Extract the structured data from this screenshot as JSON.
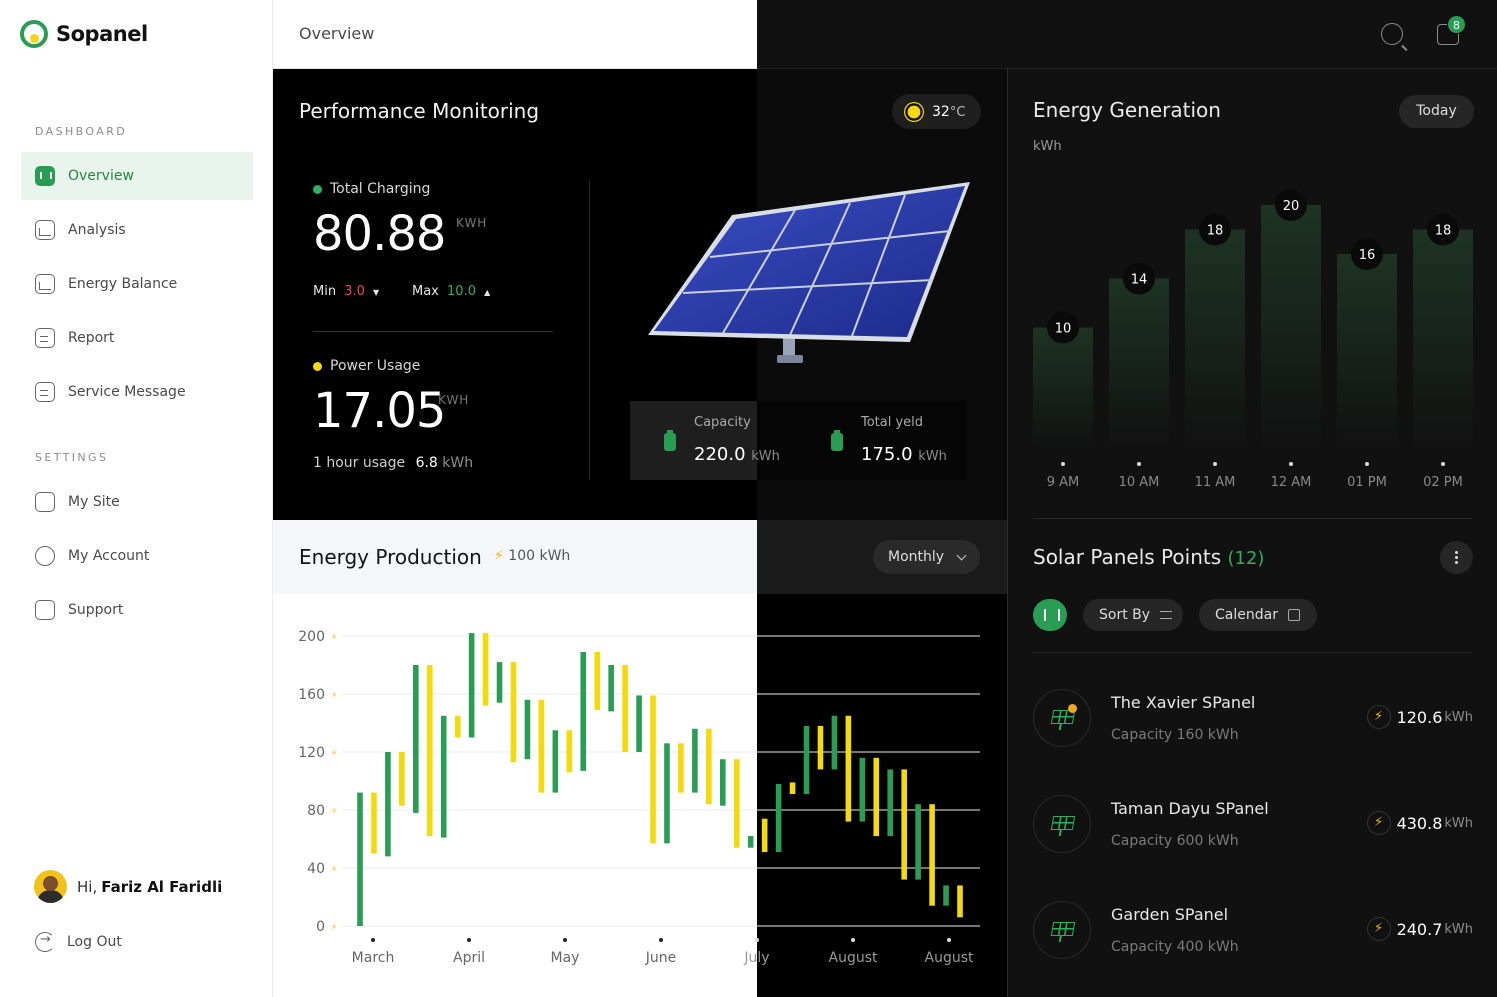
{
  "app": {
    "name": "Sopanel"
  },
  "sidebar": {
    "sections": [
      {
        "label": "DASHBOARD"
      },
      {
        "label": "SETTINGS"
      }
    ],
    "items": [
      {
        "label": "Overview",
        "icon": "overview-icon",
        "active": true
      },
      {
        "label": "Analysis",
        "icon": "analysis-icon"
      },
      {
        "label": "Energy Balance",
        "icon": "energy-balance-icon"
      },
      {
        "label": "Report",
        "icon": "report-icon"
      },
      {
        "label": "Service Message",
        "icon": "service-message-icon"
      },
      {
        "label": "My Site",
        "icon": "my-site-icon"
      },
      {
        "label": "My Account",
        "icon": "my-account-icon"
      },
      {
        "label": "Support",
        "icon": "support-icon"
      }
    ],
    "user": {
      "greeting": "Hi,",
      "name": "Fariz Al Faridli"
    },
    "logout": "Log Out"
  },
  "header": {
    "title": "Overview",
    "notification_count": "8"
  },
  "performance": {
    "title": "Performance Monitoring",
    "temperature": "32",
    "temperature_unit": "°C",
    "total_charging": {
      "label": "Total Charging",
      "value": "80.88",
      "unit": "KWH",
      "min_label": "Min",
      "min": "3.0",
      "max_label": "Max",
      "max": "10.0"
    },
    "power_usage": {
      "label": "Power Usage",
      "value": "17.05",
      "unit": "KWH",
      "usage_label": "1 hour usage",
      "usage_value": "6.8",
      "usage_unit": "kWh"
    },
    "capacity": {
      "label": "Capacity",
      "value": "220.0",
      "unit": "kWh"
    },
    "total_yield": {
      "label": "Total yeld",
      "value": "175.0",
      "unit": "kWh"
    }
  },
  "production": {
    "title": "Energy Production",
    "total": "100 kWh",
    "period": "Monthly"
  },
  "generation": {
    "title": "Energy Generation",
    "unit": "kWh",
    "period": "Today"
  },
  "solar_panels": {
    "title": "Solar Panels Points",
    "count": "(12)",
    "sort_label": "Sort By",
    "calendar_label": "Calendar",
    "items": [
      {
        "name": "The Xavier SPanel",
        "capacity": "Capacity 160 kWh",
        "value": "120.6",
        "unit": "kWh",
        "alert": true
      },
      {
        "name": "Taman Dayu SPanel",
        "capacity": "Capacity 600 kWh",
        "value": "430.8",
        "unit": "kWh"
      },
      {
        "name": "Garden SPanel",
        "capacity": "Capacity 400 kWh",
        "value": "240.7",
        "unit": "kWh"
      }
    ]
  },
  "colors": {
    "accent_green": "#2a9d55",
    "accent_yellow": "#f5d90e",
    "down_red": "#e94b4b",
    "up_green": "#2fae5e"
  },
  "chart_data": [
    {
      "type": "bar",
      "name": "Energy Production",
      "chart_style": "floating range bars (candlestick-like), alternating green/yellow",
      "ylim": [
        0,
        200
      ],
      "yticks": [
        0,
        40,
        80,
        120,
        160,
        200
      ],
      "x_ticks": [
        "March",
        "April",
        "May",
        "June",
        "July",
        "August",
        "August"
      ],
      "ranges": [
        {
          "low": 0,
          "high": 92,
          "color": "green"
        },
        {
          "low": 50,
          "high": 92,
          "color": "yellow"
        },
        {
          "low": 48,
          "high": 120,
          "color": "green"
        },
        {
          "low": 83,
          "high": 120,
          "color": "yellow"
        },
        {
          "low": 78,
          "high": 180,
          "color": "green"
        },
        {
          "low": 62,
          "high": 180,
          "color": "yellow"
        },
        {
          "low": 61,
          "high": 145,
          "color": "green"
        },
        {
          "low": 130,
          "high": 145,
          "color": "yellow"
        },
        {
          "low": 130,
          "high": 202,
          "color": "green"
        },
        {
          "low": 152,
          "high": 202,
          "color": "yellow"
        },
        {
          "low": 154,
          "high": 182,
          "color": "green"
        },
        {
          "low": 113,
          "high": 182,
          "color": "yellow"
        },
        {
          "low": 115,
          "high": 156,
          "color": "green"
        },
        {
          "low": 92,
          "high": 156,
          "color": "yellow"
        },
        {
          "low": 92,
          "high": 135,
          "color": "green"
        },
        {
          "low": 106,
          "high": 135,
          "color": "yellow"
        },
        {
          "low": 107,
          "high": 189,
          "color": "green"
        },
        {
          "low": 149,
          "high": 189,
          "color": "yellow"
        },
        {
          "low": 148,
          "high": 180,
          "color": "green"
        },
        {
          "low": 120,
          "high": 180,
          "color": "yellow"
        },
        {
          "low": 120,
          "high": 159,
          "color": "green"
        },
        {
          "low": 57,
          "high": 159,
          "color": "yellow"
        },
        {
          "low": 57,
          "high": 126,
          "color": "green"
        },
        {
          "low": 92,
          "high": 126,
          "color": "yellow"
        },
        {
          "low": 92,
          "high": 136,
          "color": "green"
        },
        {
          "low": 84,
          "high": 136,
          "color": "yellow"
        },
        {
          "low": 83,
          "high": 115,
          "color": "green"
        },
        {
          "low": 54,
          "high": 115,
          "color": "yellow"
        },
        {
          "low": 54,
          "high": 62,
          "color": "green"
        },
        {
          "low": 51,
          "high": 74,
          "color": "yellow"
        },
        {
          "low": 51,
          "high": 98,
          "color": "green"
        },
        {
          "low": 91,
          "high": 99,
          "color": "yellow"
        },
        {
          "low": 91,
          "high": 138,
          "color": "green"
        },
        {
          "low": 108,
          "high": 138,
          "color": "yellow"
        },
        {
          "low": 108,
          "high": 145,
          "color": "green"
        },
        {
          "low": 72,
          "high": 145,
          "color": "yellow"
        },
        {
          "low": 72,
          "high": 116,
          "color": "green"
        },
        {
          "low": 62,
          "high": 116,
          "color": "yellow"
        },
        {
          "low": 62,
          "high": 108,
          "color": "green"
        },
        {
          "low": 32,
          "high": 108,
          "color": "yellow"
        },
        {
          "low": 32,
          "high": 84,
          "color": "green"
        },
        {
          "low": 14,
          "high": 84,
          "color": "yellow"
        },
        {
          "low": 14,
          "high": 28,
          "color": "green"
        },
        {
          "low": 6,
          "high": 28,
          "color": "yellow"
        }
      ]
    },
    {
      "type": "bar",
      "name": "Energy Generation",
      "ylabel": "kWh",
      "categories": [
        "9 AM",
        "10 AM",
        "11 AM",
        "12 AM",
        "01 PM",
        "02 PM"
      ],
      "values": [
        10,
        14,
        18,
        20,
        16,
        18
      ],
      "ylim": [
        0,
        20
      ]
    }
  ]
}
